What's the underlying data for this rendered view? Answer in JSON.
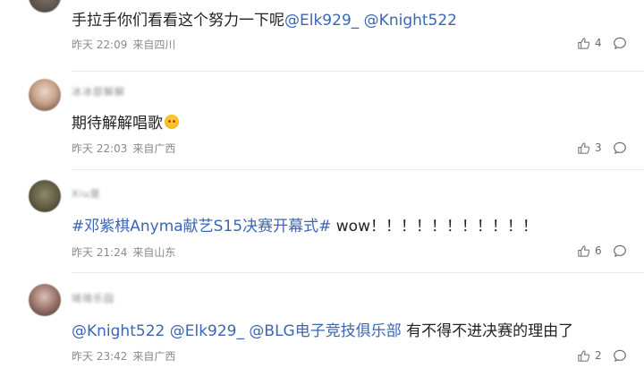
{
  "comments": [
    {
      "username": "",
      "text_prefix": "手拉手你们看看这个努力一下呢",
      "mentions": [
        "@Elk929_",
        "@Knight522"
      ],
      "time": "昨天 22:09",
      "location": "来自四川",
      "likes": "4"
    },
    {
      "username": "冰冰部解解",
      "text": "期待解解唱歌",
      "emoji": "face-emoji",
      "time": "昨天 22:03",
      "location": "来自广西",
      "likes": "3"
    },
    {
      "username": "Xiu是",
      "hashtag": "#邓紫棋Anyma献艺S15决赛开幕式#",
      "text_suffix": " wow！！！！！！！！！！！",
      "time": "昨天 21:24",
      "location": "来自山东",
      "likes": "6"
    },
    {
      "username": "琦琦乐园",
      "mentions": [
        "@Knight522",
        "@Elk929_",
        "@BLG电子竞技俱乐部"
      ],
      "text_suffix": "有不得不进决赛的理由了",
      "time": "昨天 23:42",
      "location": "来自广西",
      "likes": "2"
    }
  ],
  "icons": {
    "like": "thumbs-up-icon",
    "reply": "comment-bubble-icon"
  },
  "colors": {
    "link": "#3b66b5",
    "meta": "#8a8a8a",
    "divider": "#e8e8e8"
  }
}
